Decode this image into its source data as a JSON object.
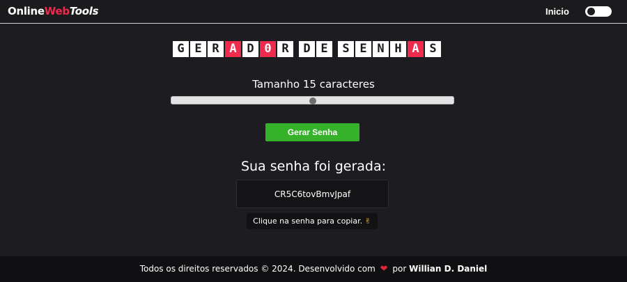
{
  "navbar": {
    "logo": {
      "part1": "Online",
      "part2": "Web",
      "part3": "Tools"
    },
    "nav_link": "Inicio",
    "theme_toggle": {
      "state": "off"
    }
  },
  "title": {
    "letters": [
      {
        "char": "G",
        "highlight": false
      },
      {
        "char": "E",
        "highlight": false
      },
      {
        "char": "R",
        "highlight": false
      },
      {
        "char": "A",
        "highlight": true
      },
      {
        "char": "D",
        "highlight": false
      },
      {
        "char": "0",
        "highlight": true
      },
      {
        "char": "R",
        "highlight": false
      },
      {
        "char": " ",
        "highlight": false
      },
      {
        "char": "D",
        "highlight": false
      },
      {
        "char": "E",
        "highlight": false
      },
      {
        "char": " ",
        "highlight": false
      },
      {
        "char": "S",
        "highlight": false
      },
      {
        "char": "E",
        "highlight": false
      },
      {
        "char": "N",
        "highlight": false
      },
      {
        "char": "H",
        "highlight": false
      },
      {
        "char": "A",
        "highlight": true
      },
      {
        "char": "S",
        "highlight": false
      }
    ]
  },
  "generator": {
    "size_label": "Tamanho 15 caracteres",
    "slider_fraction": 0.5,
    "button_label": "Gerar Senha"
  },
  "result": {
    "title": "Sua senha foi gerada:",
    "password": "CR5C6tovBmvJpaf",
    "hint_text": "Clique na senha para copiar.",
    "hint_emoji": "✌"
  },
  "footer": {
    "text": "Todos os direitos reservados © 2024. Desenvolvido com",
    "heart": "❤",
    "by": "por",
    "author": "Willian D. Daniel"
  },
  "colors": {
    "background": "#1d1c20",
    "accent_pink": "#ee2a4d",
    "button_green": "#36b22a",
    "footer_bg": "#101012"
  }
}
